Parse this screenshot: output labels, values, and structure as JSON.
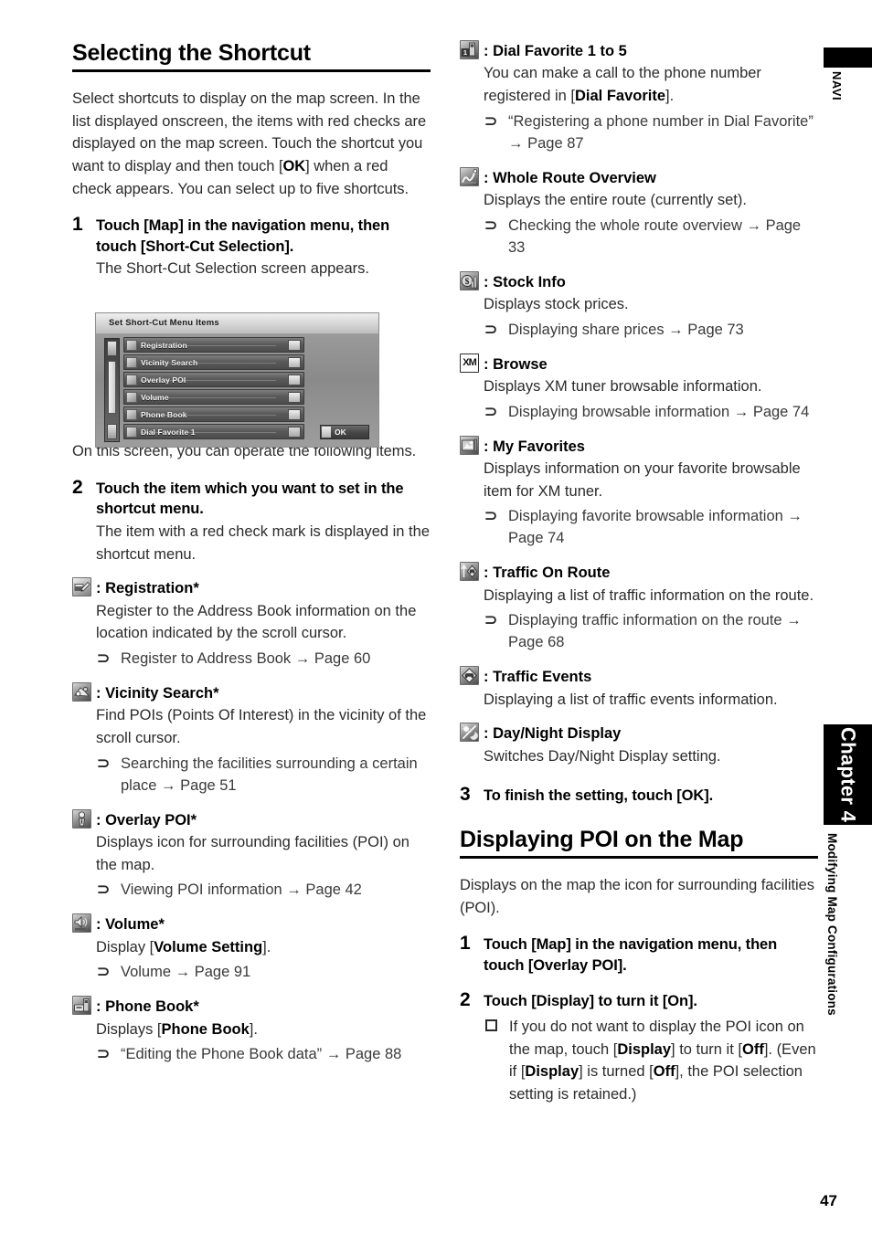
{
  "page_number": "47",
  "margin": {
    "navi_label": "NAVI",
    "chapter_tab": "Chapter 4",
    "chapter_subtitle": "Modifying Map Configurations"
  },
  "left_column": {
    "title": "Selecting the Shortcut",
    "intro_1": "Select shortcuts to display on the map screen. In the list displayed onscreen, the items with red checks are displayed on the map screen. Touch the shortcut you want to display and then touch [",
    "intro_ok": "OK",
    "intro_2": "] when a red check appears. You can select up to five shortcuts.",
    "step1": {
      "num": "1",
      "head": "Touch [Map] in the navigation menu, then touch [Short-Cut Selection].",
      "body": "The Short-Cut Selection screen appears."
    },
    "after_shot": "On this screen, you can operate the following items.",
    "step2": {
      "num": "2",
      "head": "Touch the item which you want to set in the shortcut menu.",
      "body": "The item with a red check mark is displayed in the shortcut menu."
    },
    "items": [
      {
        "icon": "registration-icon",
        "name": ": Registration*",
        "desc": "Register to the Address Book information on the location indicated by the scroll cursor.",
        "xrefs": [
          {
            "mark": "⊃",
            "text": "Register to Address Book",
            "arrow": "→",
            "page": "Page 60"
          }
        ]
      },
      {
        "icon": "vicinity-search-icon",
        "name": ": Vicinity Search*",
        "desc": "Find POIs (Points Of Interest) in the vicinity of the scroll cursor.",
        "xrefs": [
          {
            "mark": "⊃",
            "text": "Searching the facilities surrounding a certain place",
            "arrow": "→",
            "page": "Page 51"
          }
        ]
      },
      {
        "icon": "overlay-poi-icon",
        "name": ": Overlay POI*",
        "desc": "Displays icon for surrounding facilities (POI) on the map.",
        "xrefs": [
          {
            "mark": "⊃",
            "text": "Viewing POI information",
            "arrow": "→",
            "page": "Page 42"
          }
        ]
      },
      {
        "icon": "volume-icon",
        "name": ": Volume*",
        "desc_pre": "Display [",
        "desc_bold": "Volume Setting",
        "desc_post": "].",
        "xrefs": [
          {
            "mark": "⊃",
            "text": "Volume",
            "arrow": "→",
            "page": "Page 91"
          }
        ]
      },
      {
        "icon": "phone-book-icon",
        "name": ": Phone Book*",
        "desc_pre": "Displays [",
        "desc_bold": "Phone Book",
        "desc_post": "].",
        "xrefs": [
          {
            "mark": "⊃",
            "text": "“Editing the Phone Book data”",
            "arrow": "→",
            "page": "Page 88"
          }
        ]
      }
    ]
  },
  "right_column": {
    "items": [
      {
        "icon": "dial-favorite-icon",
        "name": ": Dial Favorite 1 to 5",
        "desc_pre": "You can make a call to the phone number registered in [",
        "desc_bold": "Dial Favorite",
        "desc_post": "].",
        "xrefs": [
          {
            "mark": "⊃",
            "text": "“Registering a phone number in Dial Favorite”",
            "arrow": "→",
            "page": "Page 87"
          }
        ]
      },
      {
        "icon": "whole-route-overview-icon",
        "name": ": Whole Route Overview",
        "desc": "Displays the entire route (currently set).",
        "xrefs": [
          {
            "mark": "⊃",
            "text": "Checking the whole route overview",
            "arrow": "→",
            "page": "Page 33"
          }
        ]
      },
      {
        "icon": "stock-info-icon",
        "name": ": Stock Info",
        "desc": "Displays stock prices.",
        "xrefs": [
          {
            "mark": "⊃",
            "text": "Displaying share prices",
            "arrow": "→",
            "page": "Page 73"
          }
        ]
      },
      {
        "icon": "xm-browse-icon",
        "icon_text": "XM",
        "name": ": Browse",
        "desc": "Displays XM tuner browsable information.",
        "xrefs": [
          {
            "mark": "⊃",
            "text": "Displaying browsable information",
            "arrow": "→",
            "page": "Page 74"
          }
        ]
      },
      {
        "icon": "my-favorites-icon",
        "name": ": My Favorites",
        "desc": "Displays information on your favorite browsable item for XM tuner.",
        "xrefs": [
          {
            "mark": "⊃",
            "text": "Displaying favorite browsable information",
            "arrow": "→",
            "page": "Page 74"
          }
        ]
      },
      {
        "icon": "traffic-on-route-icon",
        "name": ": Traffic On Route",
        "desc": "Displaying a list of traffic information on the route.",
        "xrefs": [
          {
            "mark": "⊃",
            "text": "Displaying traffic information on the route",
            "arrow": "→",
            "page": "Page 68"
          }
        ]
      },
      {
        "icon": "traffic-events-icon",
        "name": ": Traffic Events",
        "desc": "Displaying a list of traffic events information.",
        "xrefs": []
      },
      {
        "icon": "day-night-display-icon",
        "name": ": Day/Night Display",
        "desc": "Switches Day/Night Display setting.",
        "xrefs": []
      }
    ],
    "step3": {
      "num": "3",
      "head": "To finish the setting, touch [OK]."
    },
    "title": "Displaying POI on the Map",
    "intro": "Displays on the map the icon for surrounding facilities (POI).",
    "step1": {
      "num": "1",
      "head": "Touch [Map] in the navigation menu, then touch [Overlay POI]."
    },
    "step2": {
      "num": "2",
      "head": "Touch [Display] to turn it [On].",
      "note_1": "If you do not want to display the POI icon on the map, touch [",
      "note_b1": "Display",
      "note_2": "] to turn it [",
      "note_b2": "Off",
      "note_3": "]. (Even if [",
      "note_b3": "Display",
      "note_4": "] is turned [",
      "note_b4": "Off",
      "note_5": "], the POI selection setting is retained.)"
    }
  },
  "navshot": {
    "title": "Set Short-Cut Menu Items",
    "rows": [
      {
        "label": "Registration",
        "checked": true
      },
      {
        "label": "Vicinity Search",
        "checked": true
      },
      {
        "label": "Overlay POI",
        "checked": true
      },
      {
        "label": "Volume",
        "checked": true
      },
      {
        "label": "Phone Book",
        "checked": true
      },
      {
        "label": "Dial Favorite 1",
        "checked": false
      }
    ],
    "ok_label": "OK"
  }
}
